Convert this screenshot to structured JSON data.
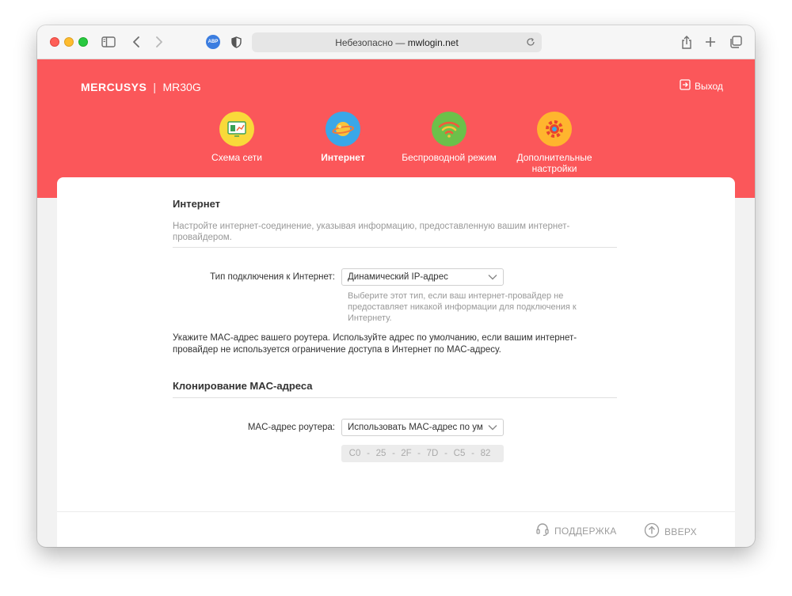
{
  "browser": {
    "url_prefix": "Небезопасно —",
    "url_host": "mwlogin.net",
    "adblock_label": "ABP"
  },
  "header": {
    "brand": "MERCUSYS",
    "separator": "|",
    "model": "MR30G",
    "logout_label": "Выход"
  },
  "nav": {
    "items": [
      {
        "label": "Схема сети",
        "icon": "network-map-icon",
        "color": "#f9d93a"
      },
      {
        "label": "Интернет",
        "icon": "globe-icon",
        "color": "#3aa7e8",
        "active": true
      },
      {
        "label": "Беспроводной режим",
        "icon": "wifi-icon",
        "color": "#6cc04a"
      },
      {
        "label": "Дополнительные настройки",
        "icon": "gear-icon",
        "color": "#ffb52e"
      }
    ]
  },
  "internet": {
    "title": "Интернет",
    "description": "Настройте интернет-соединение, указывая информацию, предоставленную вашим интернет-провайдером.",
    "connection_type_label": "Тип подключения к Интернет:",
    "connection_type_value": "Динамический IP-адрес",
    "connection_type_hint": "Выберите этот тип, если ваш интернет-провайдер не предоставляет никакой информации для подключения к Интернету.",
    "mac_note": "Укажите MAC-адрес вашего роутера. Используйте адрес по умолчанию, если вашим интернет-провайдер не используется ограничение доступа в Интернет по MAC-адресу."
  },
  "mac_clone": {
    "title": "Клонирование MAC-адреса",
    "router_mac_label": "MAC-адрес роутера:",
    "router_mac_value": "Использовать MAC-адрес по ум",
    "mac_octets": [
      "C0",
      "25",
      "2F",
      "7D",
      "C5",
      "82"
    ]
  },
  "footer": {
    "support_label": "ПОДДЕРЖКА",
    "top_label": "ВВЕРХ"
  },
  "colors": {
    "header_bg": "#fb575a",
    "panel_bg": "#ffffff"
  }
}
